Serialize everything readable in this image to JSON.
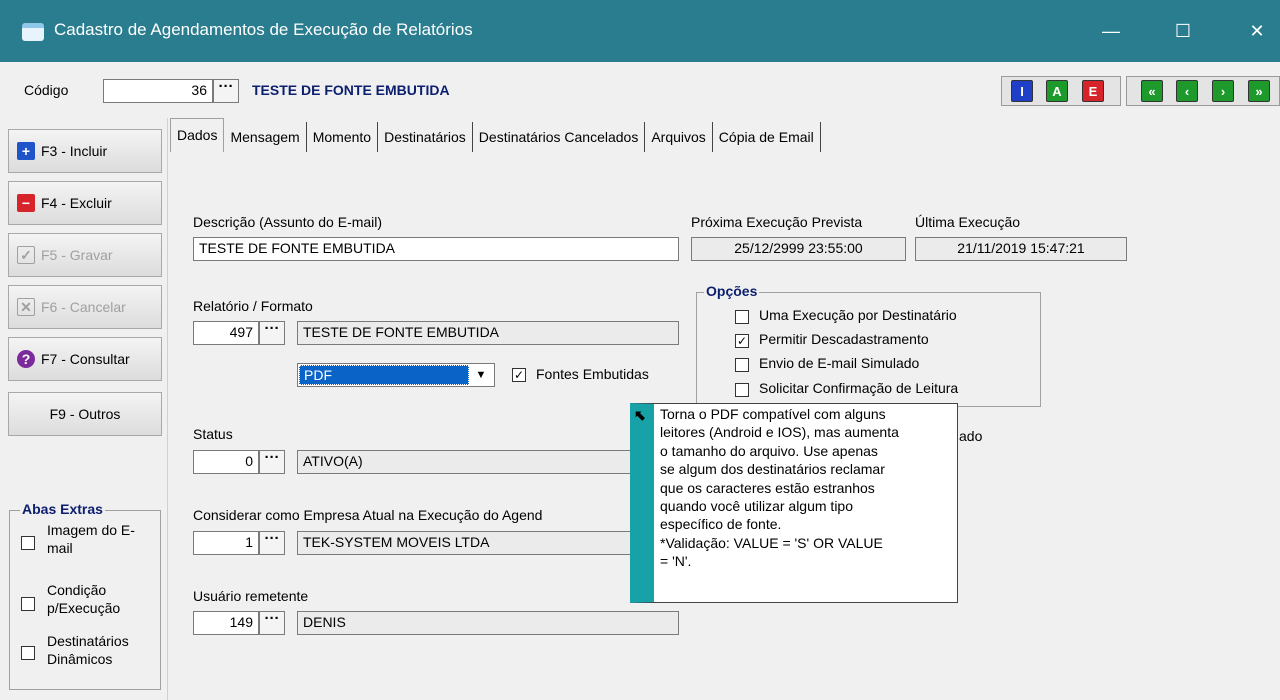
{
  "window": {
    "title": "Cadastro de Agendamentos de Execução de Relatórios",
    "min": "—",
    "max": "☐",
    "close": "✕"
  },
  "header": {
    "codigo_label": "Código",
    "codigo_value": "36",
    "record_title": "TESTE DE FONTE EMBUTIDA",
    "mode_buttons": [
      {
        "letter": "I",
        "color": "#1f3fc8"
      },
      {
        "letter": "A",
        "color": "#1e9a2c"
      },
      {
        "letter": "E",
        "color": "#d6242a"
      }
    ],
    "nav_buttons": [
      {
        "glyph": "«",
        "color": "#1e9a2c"
      },
      {
        "glyph": "‹",
        "color": "#1e9a2c"
      },
      {
        "glyph": "›",
        "color": "#1e9a2c"
      },
      {
        "glyph": "»",
        "color": "#1e9a2c"
      }
    ]
  },
  "sidebar": {
    "incluir": "F3 - Incluir",
    "excluir": "F4 - Excluir",
    "gravar": "F5 - Gravar",
    "cancelar": "F6 - Cancelar",
    "consultar": "F7 - Consultar",
    "outros": "F9 - Outros",
    "abas_extras": {
      "title": "Abas Extras",
      "imagem": "Imagem do E-mail",
      "condicao": "Condição p/Execução",
      "dinamicos": "Destinatários Dinâmicos"
    }
  },
  "tabs": [
    "Dados",
    "Mensagem",
    "Momento",
    "Destinatários",
    "Destinatários Cancelados",
    "Arquivos",
    "Cópia de Email"
  ],
  "form": {
    "descricao_label": "Descrição (Assunto do E-mail)",
    "descricao_value": "TESTE DE FONTE EMBUTIDA",
    "proxima_label": "Próxima Execução Prevista",
    "proxima_value": "25/12/2999 23:55:00",
    "ultima_label": "Última Execução",
    "ultima_value": "21/11/2019 15:47:21",
    "relatorio_label": "Relatório / Formato",
    "relatorio_code": "497",
    "relatorio_name": "TESTE DE FONTE EMBUTIDA",
    "formato_value": "PDF",
    "fontes_label": "Fontes Embutidas",
    "status_label": "Status",
    "status_code": "0",
    "status_name": "ATIVO(A)",
    "empresa_label": "Considerar como Empresa Atual na Execução do Agend",
    "empresa_code": "1",
    "empresa_name": "TEK-SYSTEM MOVEIS LTDA",
    "usuario_label": "Usuário remetente",
    "usuario_code": "149",
    "usuario_name": "DENIS",
    "opcoes": {
      "title": "Opções",
      "uma": "Uma Execução por Destinatário",
      "permitir": "Permitir Descadastramento",
      "envio": "Envio de E-mail Simulado",
      "solicitar": "Solicitar Confirmação de Leitura",
      "partial": "ado"
    }
  },
  "tooltip": {
    "lines": [
      "Torna o PDF compatível com alguns",
      "leitores (Android e IOS), mas aumenta",
      "o tamanho do arquivo. Use apenas",
      "se algum dos destinatários reclamar",
      "que os caracteres estão estranhos",
      "quando você utilizar algum tipo",
      "específico de fonte.",
      "*Validação: VALUE = 'S' OR VALUE",
      "= 'N'."
    ]
  }
}
